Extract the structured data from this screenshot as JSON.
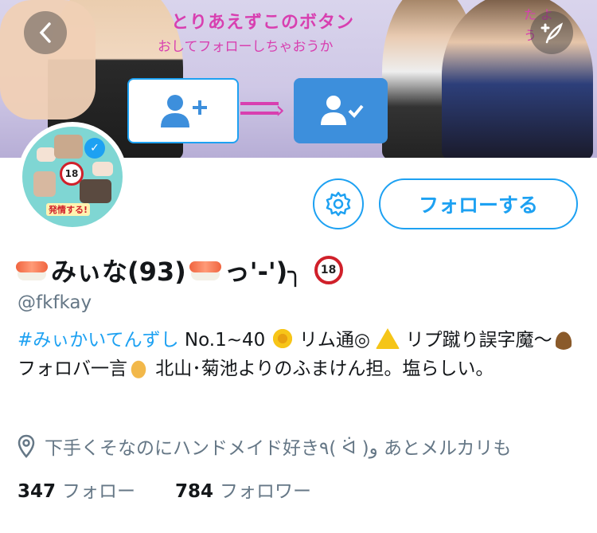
{
  "banner": {
    "line1": "とりあえずこのボタン",
    "line2": "おしてフォローしちゃおうか",
    "side_text": "た よう"
  },
  "top_bar": {
    "back_icon": "chevron-left-icon",
    "compose_icon": "compose-feather-icon"
  },
  "avatar": {
    "caption": "発情する!",
    "badge": "18"
  },
  "actions": {
    "settings_icon": "gear-icon",
    "follow_label": "フォローする"
  },
  "profile": {
    "display_name_text": "みぃな(93)",
    "display_name_suffix": "っ'-')╮",
    "handle": "@fkfkay",
    "bio": {
      "hashtag": "#みぃかいてんずし",
      "part1": " No.1~40",
      "part2": " リム通◎ ",
      "part3": " リプ蹴り誤字魔〜",
      "part4": " フォロバ一言",
      "part5": " 北山･菊池よりのふまけん担。塩らしい。"
    },
    "location": "下手くそなのにハンドメイド好き٩( ᐛ )و あとメルカリも",
    "following_count": "347",
    "following_label": "フォロー",
    "followers_count": "784",
    "followers_label": "フォロワー"
  },
  "colors": {
    "accent": "#1da1f2",
    "banner_text": "#d83fb0",
    "muted": "#657786"
  }
}
